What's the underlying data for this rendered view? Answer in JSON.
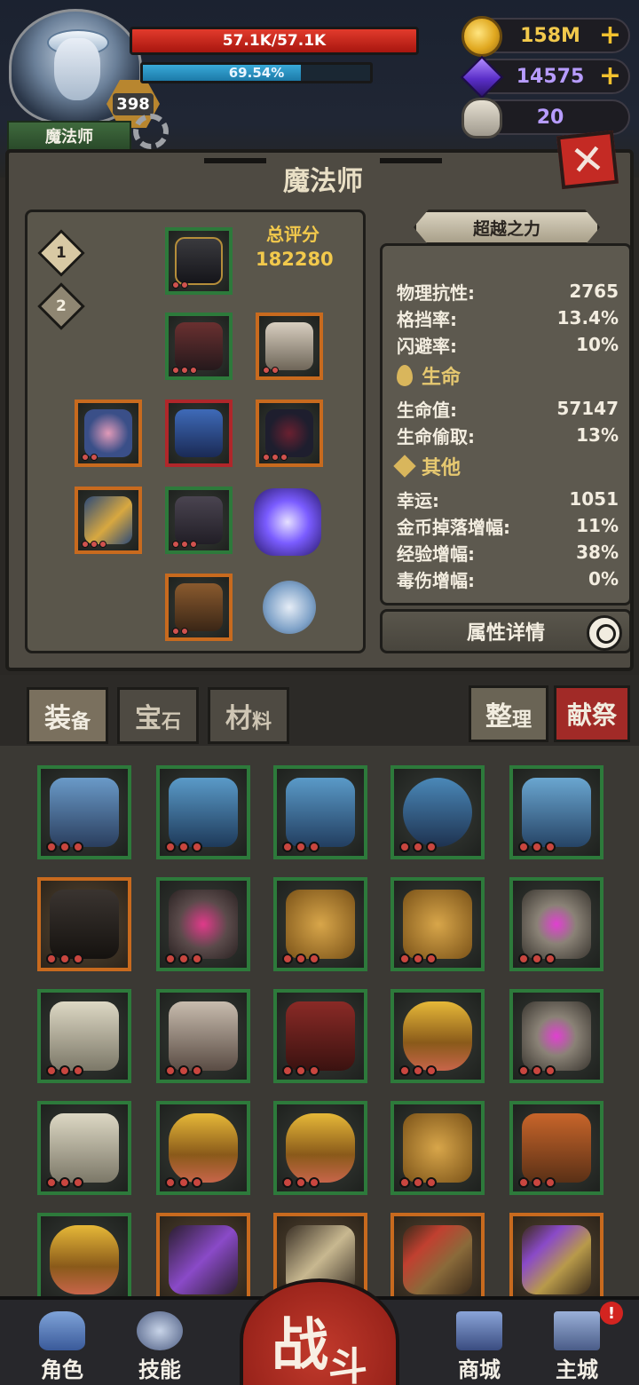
{
  "hud": {
    "level": "398",
    "class_name": "魔法师",
    "hp_text": "57.1K/57.1K",
    "hp_fraction": 1.0,
    "xp_text": "69.54%",
    "xp_fraction": 0.6954,
    "gold": "158M",
    "gems": "14575",
    "skulls": "20"
  },
  "panel": {
    "title": "魔法师",
    "loadouts": [
      "1",
      "2"
    ],
    "score_label": "总评分",
    "score_value": "182280",
    "ribbon": "超越之力",
    "stats": [
      {
        "label": "物理抗性:",
        "value": "2765"
      },
      {
        "label": "格挡率:",
        "value": "13.4%"
      },
      {
        "label": "闪避率:",
        "value": "10%"
      }
    ],
    "life_header": "生命",
    "life_stats": [
      {
        "label": "生命值:",
        "value": "57147"
      },
      {
        "label": "生命偷取:",
        "value": "13%"
      }
    ],
    "other_header": "其他",
    "other_stats": [
      {
        "label": "幸运:",
        "value": "1051"
      },
      {
        "label": "金币掉落增幅:",
        "value": "11%"
      },
      {
        "label": "经验增幅:",
        "value": "38%"
      },
      {
        "label": "毒伤增幅:",
        "value": "0%"
      }
    ],
    "detail_button": "属性详情"
  },
  "inventory": {
    "tabs": [
      {
        "big": "装",
        "small": "备"
      },
      {
        "big": "宝",
        "small": "石"
      },
      {
        "big": "材",
        "small": "料"
      }
    ],
    "sort_big": "整",
    "sort_small": "理",
    "sacrifice": "献祭"
  },
  "nav": {
    "role": "角色",
    "skills": "技能",
    "battle_big": "战",
    "battle_small": "斗",
    "shop": "商城",
    "city": "主城",
    "alert": "!"
  },
  "colors": {
    "hp": "#c8251c",
    "xp": "#2a94c4",
    "gold_text": "#f2c94c",
    "gem_text": "#b79cff",
    "rare_border": "#2d7a3b",
    "epic_border": "#c86a1e",
    "legend_border": "#b0262a"
  }
}
